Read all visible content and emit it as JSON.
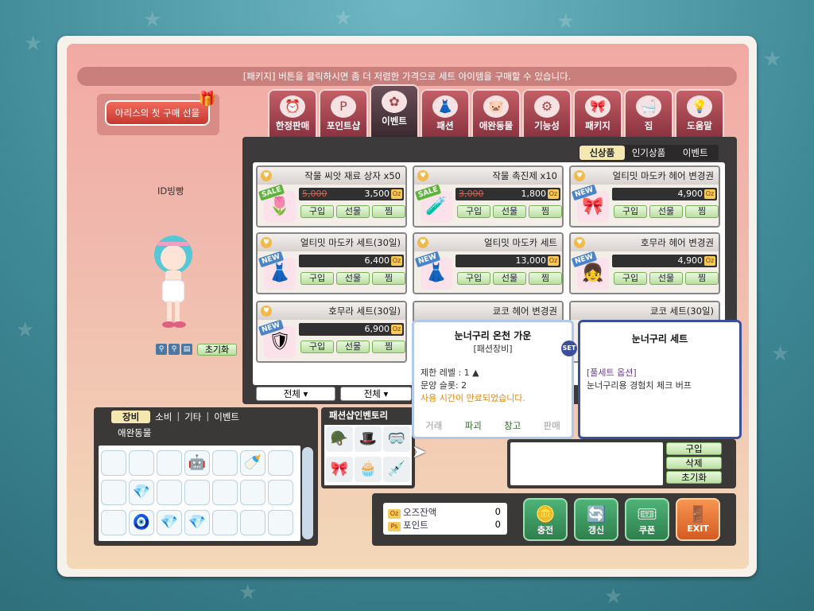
{
  "notice": "[패키지] 버튼을 클릭하시면 좀 더 저렴한 가격으로 세트 아이템을 구매할 수 있습니다.",
  "first_gift": "아리스의 첫 구매 선물",
  "categories": [
    {
      "label": "한정판매",
      "icon": "clock-icon",
      "glyph": "⏰"
    },
    {
      "label": "포인트샵",
      "icon": "point-icon",
      "glyph": "P"
    },
    {
      "label": "이벤트",
      "icon": "flower-icon",
      "glyph": "✿"
    },
    {
      "label": "패션",
      "icon": "hanger-icon",
      "glyph": "👗"
    },
    {
      "label": "애완동물",
      "icon": "pet-icon",
      "glyph": "🐷"
    },
    {
      "label": "기능성",
      "icon": "gears-icon",
      "glyph": "⚙"
    },
    {
      "label": "패키지",
      "icon": "ribbon-icon",
      "glyph": "🎀"
    },
    {
      "label": "집",
      "icon": "bathtub-icon",
      "glyph": "🛁"
    },
    {
      "label": "도움말",
      "icon": "lightbulb-icon",
      "glyph": "💡"
    }
  ],
  "subtabs": [
    "신상품",
    "인기상품",
    "이벤트"
  ],
  "items": [
    {
      "name": "작물 씨앗 재료 상자 x50",
      "old": "5,000",
      "price": "3,500",
      "badge": "SALE",
      "glyph": "🌷"
    },
    {
      "name": "작물 촉진제 x10",
      "old": "3,000",
      "price": "1,800",
      "badge": "SALE",
      "glyph": "🧪"
    },
    {
      "name": "얼티밋 마도카 헤어 변경권",
      "old": "",
      "price": "4,900",
      "badge": "NEW",
      "glyph": "🎀"
    },
    {
      "name": "얼티밋 마도카 세트(30일)",
      "old": "",
      "price": "6,400",
      "badge": "NEW",
      "glyph": "👗"
    },
    {
      "name": "얼티밋 마도카 세트",
      "old": "",
      "price": "13,000",
      "badge": "NEW",
      "glyph": "👗"
    },
    {
      "name": "호무라 헤어 변경권",
      "old": "",
      "price": "4,900",
      "badge": "NEW",
      "glyph": "👧"
    },
    {
      "name": "호무라 세트(30일)",
      "old": "",
      "price": "6,900",
      "badge": "NEW",
      "glyph": "🛡"
    },
    {
      "name": "쿄코 헤어 변경권",
      "old": "",
      "price": "",
      "badge": "",
      "glyph": ""
    },
    {
      "name": "쿄코 세트(30일)",
      "old": "",
      "price": "",
      "badge": "",
      "glyph": ""
    }
  ],
  "item_buttons": [
    "구입",
    "선물",
    "찜"
  ],
  "filters": [
    "전체",
    "전체"
  ],
  "character": {
    "name": "ID빙빵",
    "reset": "초기화"
  },
  "inventory": {
    "tabs": [
      "장비",
      "소비",
      "기타",
      "이벤트"
    ],
    "sub": "애완동물",
    "slots": [
      "",
      "",
      "",
      "🤖",
      "",
      "🍼",
      "",
      "",
      "💎",
      "",
      "",
      "",
      "",
      "",
      "",
      "🧿",
      "💎",
      "💎",
      "",
      "",
      ""
    ]
  },
  "fashion_inventory": {
    "title": "패션샵인벤토리",
    "slots": [
      "🪖",
      "🎩",
      "🥽",
      "🎀",
      "🧁",
      "💉",
      "🐰",
      "⚙"
    ]
  },
  "right_buttons": [
    "구입",
    "삭제",
    "초기화"
  ],
  "money": {
    "oz_label": "오즈잔액",
    "oz_value": "0",
    "oz_icon": "Oz",
    "point_label": "포인트",
    "point_value": "0",
    "point_icon": "Ps"
  },
  "big_buttons": [
    {
      "label": "충전",
      "icon": "coins-icon",
      "glyph": "🪙"
    },
    {
      "label": "갱신",
      "icon": "refresh-icon",
      "glyph": "🔄"
    },
    {
      "label": "쿠폰",
      "icon": "coupon-icon",
      "glyph": "🎟"
    },
    {
      "label": "EXIT",
      "icon": "exit-door-icon",
      "glyph": "🚪"
    }
  ],
  "tooltip_item": {
    "title": "눈너구리 온천 가운",
    "sub": "[패션장비]",
    "level": "제한 레벨 : 1 ▲",
    "slots": "문양 슬롯: 2",
    "warn": "사용 시간이 만료되었습니다.",
    "actions": [
      "거래",
      "파괴",
      "창고",
      "판매"
    ]
  },
  "tooltip_set": {
    "title": "눈너구리 세트",
    "option": "[풀세트 옵션]",
    "desc": "눈너구리용 경험치 체크 버프",
    "badge": "SET"
  }
}
